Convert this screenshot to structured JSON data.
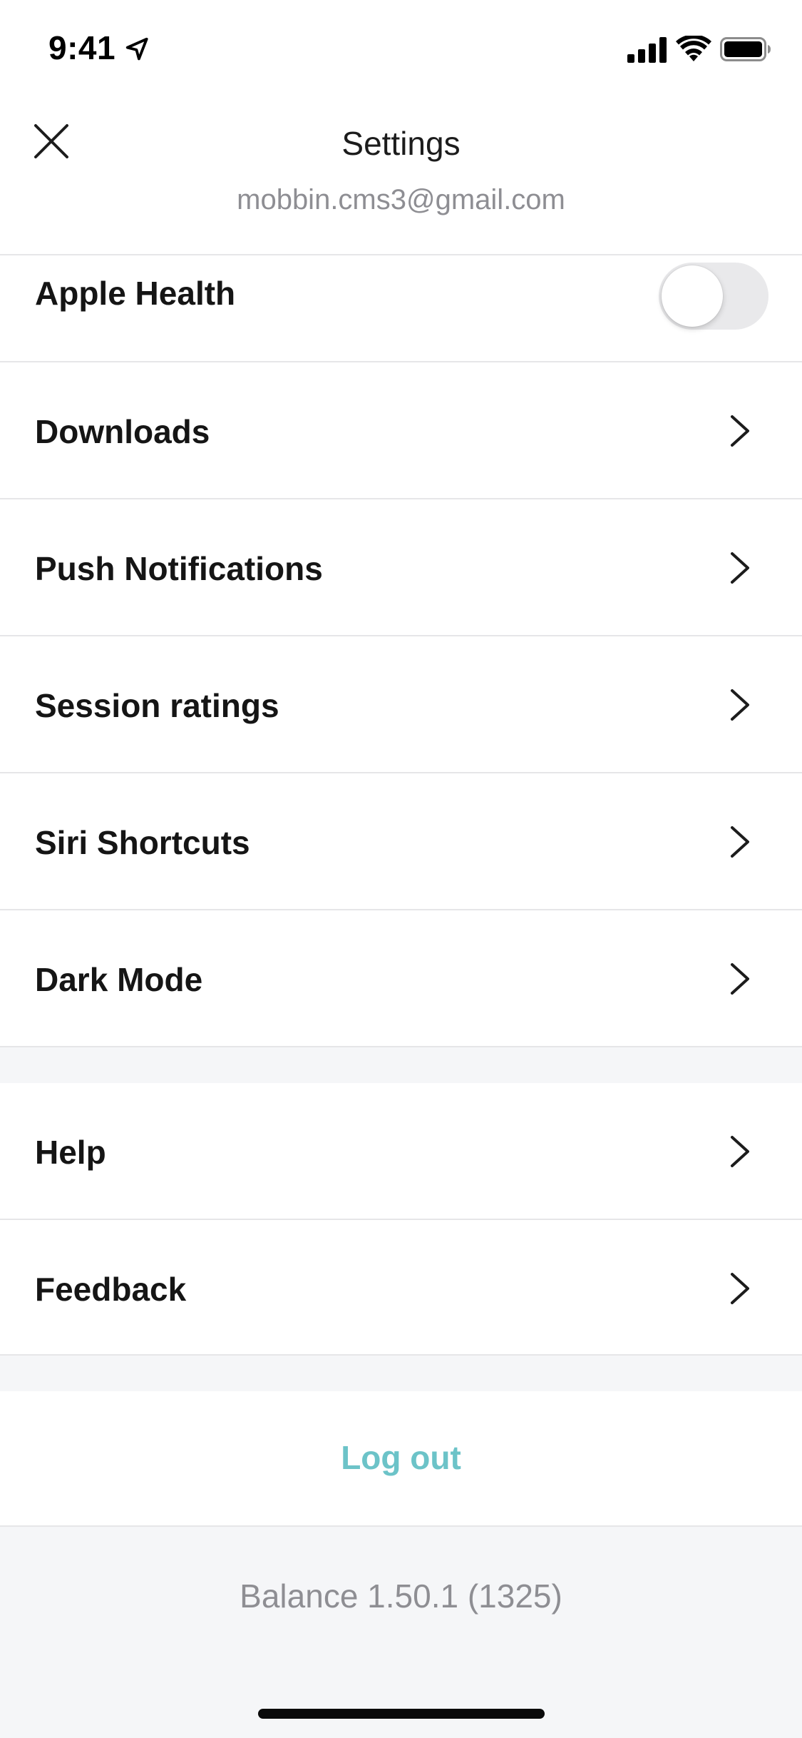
{
  "status_bar": {
    "time": "9:41",
    "icons": [
      "location-arrow-icon",
      "cellular-signal-icon",
      "wifi-icon",
      "battery-icon"
    ]
  },
  "header": {
    "title": "Settings",
    "email": "mobbin.cms3@gmail.com",
    "close_icon": "close-icon"
  },
  "settings": {
    "apple_health": {
      "label": "Apple Health",
      "toggle_on": false
    },
    "items": [
      {
        "label": "Downloads"
      },
      {
        "label": "Push Notifications"
      },
      {
        "label": "Session ratings"
      },
      {
        "label": "Siri Shortcuts"
      },
      {
        "label": "Dark Mode"
      }
    ],
    "support_items": [
      {
        "label": "Help"
      },
      {
        "label": "Feedback"
      }
    ]
  },
  "logout_label": "Log out",
  "version": "Balance 1.50.1 (1325)",
  "colors": {
    "accent": "#6cc3c8",
    "section_background": "#f5f6f8",
    "secondary_text": "#8e8e93",
    "divider": "#e6e6e8",
    "toggle_off": "#e9e9eb"
  }
}
